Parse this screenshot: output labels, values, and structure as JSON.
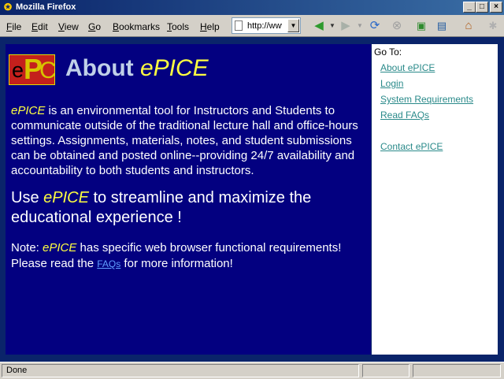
{
  "window": {
    "title": "Mozilla Firefox",
    "controls": {
      "minimize": "_",
      "maximize": "□",
      "close": "×"
    }
  },
  "menubar": [
    {
      "key": "F",
      "rest": "ile"
    },
    {
      "key": "E",
      "rest": "dit"
    },
    {
      "key": "V",
      "rest": "iew"
    },
    {
      "key": "G",
      "rest": "o"
    },
    {
      "key": "B",
      "rest": "ookmarks"
    },
    {
      "key": "T",
      "rest": "ools"
    },
    {
      "key": "H",
      "rest": "elp"
    }
  ],
  "addressbar": {
    "value": "http://www"
  },
  "toolbar_icons": [
    "back-icon",
    "forward-icon",
    "reload-icon",
    "stop-icon",
    "history-icon",
    "bookmark-icon",
    "home-icon"
  ],
  "colors": {
    "page_bg": "#030080",
    "frame_bg": "#0a246a",
    "accent": "#ffff40",
    "link": "#2a8a8a"
  },
  "page": {
    "title_prefix": "About ",
    "title_brand": "ePICE",
    "intro_brand": "ePICE",
    "intro_text": " is an environmental tool for Instructors and Students to communicate outside of the traditional lecture hall and office-hours settings. Assignments, materials, notes, and student submissions can be obtained and posted online--providing 24/7 availability and accountability to both students and instructors.",
    "slogan_pre": "Use ",
    "slogan_brand": "ePICE",
    "slogan_post": " to streamline and maximize the educational experience !",
    "note_pre": "Note: ",
    "note_brand": "ePICE",
    "note_mid": " has specific web browser functional requirements! Please read the ",
    "note_link": "FAQs",
    "note_post": " for more information!"
  },
  "sidebar": {
    "heading": "Go To:",
    "links": [
      "About ePICE",
      "Login",
      "System Requirements",
      "Read FAQs",
      "Contact ePICE"
    ]
  },
  "status": {
    "text": "Done"
  }
}
